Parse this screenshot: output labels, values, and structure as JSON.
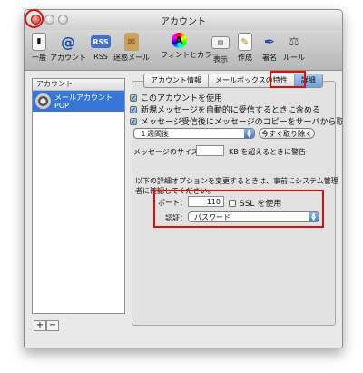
{
  "window": {
    "title": "アカウント"
  },
  "toolbar": {
    "items": [
      {
        "label": "一般",
        "icon": "general-switch-icon"
      },
      {
        "label": "アカウント",
        "icon": "at-sign-icon"
      },
      {
        "label": "RSS",
        "icon": "rss-icon"
      },
      {
        "label": "迷惑メール",
        "icon": "junk-mail-bag-icon"
      },
      {
        "label": "フォントとカラー",
        "icon": "fonts-colors-icon"
      },
      {
        "label": "表示",
        "icon": "viewing-icon"
      },
      {
        "label": "作成",
        "icon": "composing-pencil-icon"
      },
      {
        "label": "署名",
        "icon": "signature-pen-icon"
      },
      {
        "label": "ルール",
        "icon": "rules-icon"
      }
    ]
  },
  "sidebar": {
    "header": "アカウント",
    "accounts": [
      {
        "name": "メールアカウント",
        "type": "POP"
      }
    ],
    "add_label": "+",
    "remove_label": "−"
  },
  "tabs": [
    {
      "label": "アカウント情報",
      "selected": false
    },
    {
      "label": "メールボックスの特性",
      "selected": false
    },
    {
      "label": "詳細",
      "selected": true
    }
  ],
  "options": {
    "enable_account": {
      "label": "このアカウントを使用",
      "checked": true
    },
    "auto_receive": {
      "label": "新規メッセージを自動的に受信するときに含める",
      "checked": true
    },
    "delete_from_server": {
      "label": "メッセージ受信後にメッセージのコピーをサーバから取り除く：",
      "checked": true
    },
    "delete_period": "１週間後",
    "remove_now_label": "今すぐ取り除く",
    "size_warning_prefix": "メッセージのサイズが",
    "size_warning_value": "",
    "size_warning_suffix": "KB を超えるときに警告"
  },
  "advanced": {
    "note_line1": "以下の詳細オプションを変更するときは、事前にシステム管理",
    "note_line2": "者に確認してください。",
    "port_label": "ポート：",
    "port_value": "110",
    "ssl_label": "SSL を使用",
    "ssl_checked": false,
    "auth_label": "認証：",
    "auth_value": "パスワード"
  },
  "help_label": "?",
  "colors": {
    "highlight": "#d90f10",
    "selection": "#3876d6"
  }
}
